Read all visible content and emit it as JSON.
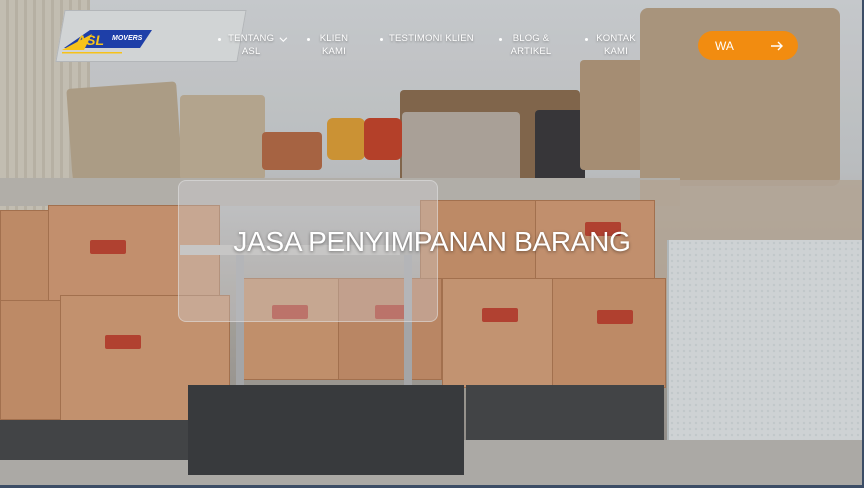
{
  "brand": {
    "logo_text": "ASL",
    "logo_subtext": "MOVERS",
    "colors": {
      "accent": "#f28c10",
      "logo_blue": "#1e3fa8",
      "logo_yellow": "#f6c21a"
    }
  },
  "nav": {
    "items": [
      {
        "label": "TENTANG ASL",
        "icon": "chevron-down-icon"
      },
      {
        "label": "KLIEN KAMI"
      },
      {
        "label": "TESTIMONI KLIEN"
      },
      {
        "label": "BLOG & ARTIKEL"
      },
      {
        "label": "KONTAK KAMI"
      }
    ]
  },
  "cta": {
    "label": "WA",
    "icon": "arrow-right-icon"
  },
  "hero": {
    "title": "JASA PENYIMPANAN BARANG"
  }
}
